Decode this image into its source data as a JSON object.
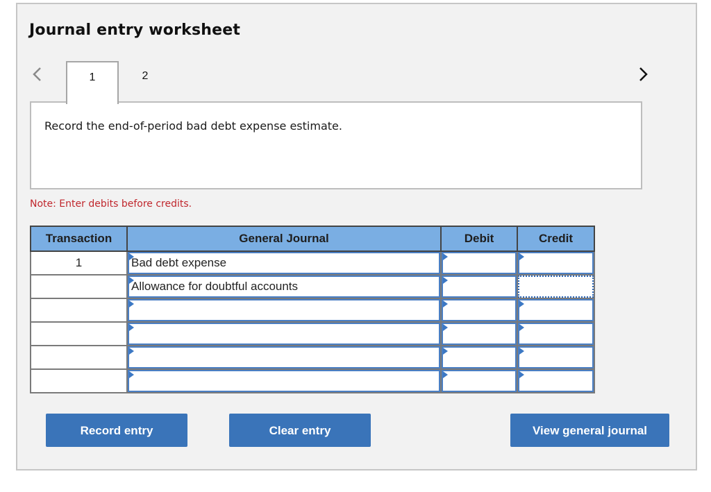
{
  "worksheet": {
    "title": "Journal entry worksheet",
    "nav": {
      "prev_icon": "chevron-left-icon",
      "next_icon": "chevron-right-icon"
    },
    "tabs": [
      {
        "label": "1",
        "active": true
      },
      {
        "label": "2",
        "active": false
      }
    ],
    "prompt": "Record the end-of-period bad debt expense estimate.",
    "note": "Note: Enter debits before credits.",
    "note_color": "#c0272d"
  },
  "table": {
    "headers": {
      "transaction": "Transaction",
      "general_journal": "General Journal",
      "debit": "Debit",
      "credit": "Credit"
    },
    "header_color": "#7aaee3",
    "rows": [
      {
        "transaction": "1",
        "account": "Bad debt expense",
        "debit": "",
        "credit": ""
      },
      {
        "transaction": "",
        "account": "Allowance for doubtful accounts",
        "debit": "",
        "credit": ""
      },
      {
        "transaction": "",
        "account": "",
        "debit": "",
        "credit": ""
      },
      {
        "transaction": "",
        "account": "",
        "debit": "",
        "credit": ""
      },
      {
        "transaction": "",
        "account": "",
        "debit": "",
        "credit": ""
      },
      {
        "transaction": "",
        "account": "",
        "debit": "",
        "credit": ""
      }
    ]
  },
  "buttons": {
    "record": "Record entry",
    "clear": "Clear entry",
    "view": "View general journal",
    "color": "#3a74b9"
  }
}
